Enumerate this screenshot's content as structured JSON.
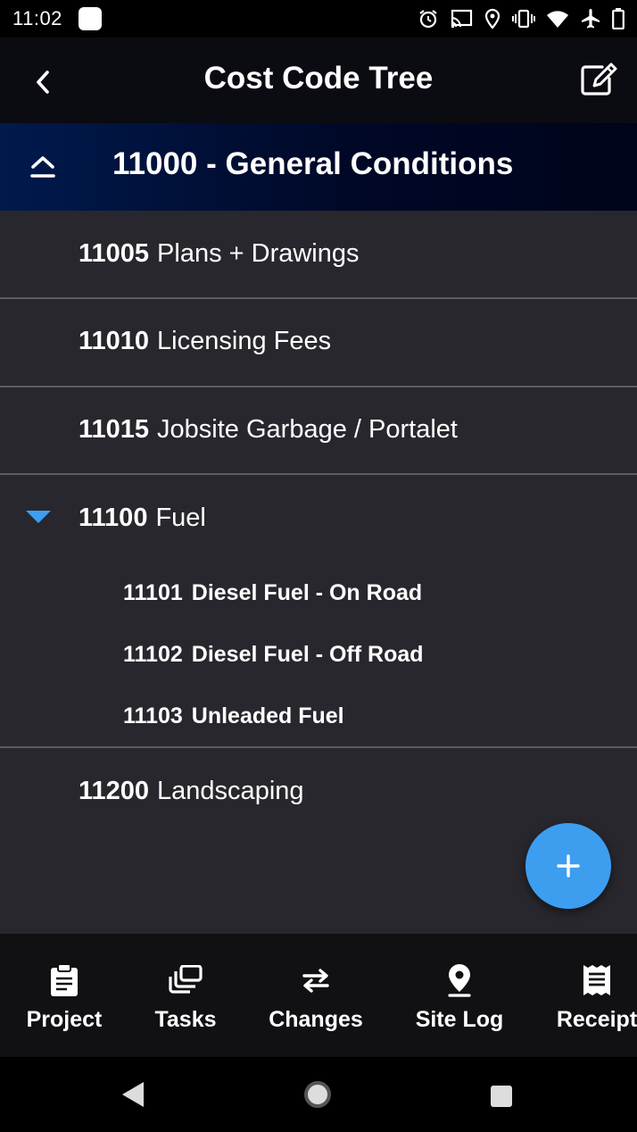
{
  "status_bar": {
    "time": "11:02",
    "icons": [
      "alarm-icon",
      "cast-icon",
      "location-icon",
      "vibrate-icon",
      "wifi-icon",
      "airplane-icon",
      "battery-icon"
    ]
  },
  "app_bar": {
    "title": "Cost Code Tree",
    "back_icon": "chevron-left-icon",
    "edit_icon": "edit-icon"
  },
  "section": {
    "title": "11000 - General Conditions",
    "collapse_icon": "collapse-up-icon"
  },
  "tree": {
    "items": [
      {
        "code": "11005",
        "label": "Plans + Drawings"
      },
      {
        "code": "11010",
        "label": "Licensing Fees"
      },
      {
        "code": "11015",
        "label": "Jobsite Garbage / Portalet"
      },
      {
        "code": "11100",
        "label": "Fuel",
        "expanded": true,
        "children": [
          {
            "code": "11101",
            "label": "Diesel Fuel - On Road"
          },
          {
            "code": "11102",
            "label": "Diesel Fuel - Off Road"
          },
          {
            "code": "11103",
            "label": "Unleaded Fuel"
          }
        ]
      },
      {
        "code": "11200",
        "label": "Landscaping"
      }
    ]
  },
  "fab": {
    "icon": "plus-icon"
  },
  "bottom_nav": {
    "items": [
      {
        "label": "Project",
        "icon": "clipboard-icon"
      },
      {
        "label": "Tasks",
        "icon": "tasks-icon"
      },
      {
        "label": "Changes",
        "icon": "swap-arrows-icon"
      },
      {
        "label": "Site Log",
        "icon": "map-pin-icon"
      },
      {
        "label": "Receipt",
        "icon": "receipt-icon"
      }
    ]
  },
  "colors": {
    "accent": "#3d9ef0",
    "section_header": "#000827",
    "tree_background": "#28272d",
    "nav_background": "#111114"
  }
}
